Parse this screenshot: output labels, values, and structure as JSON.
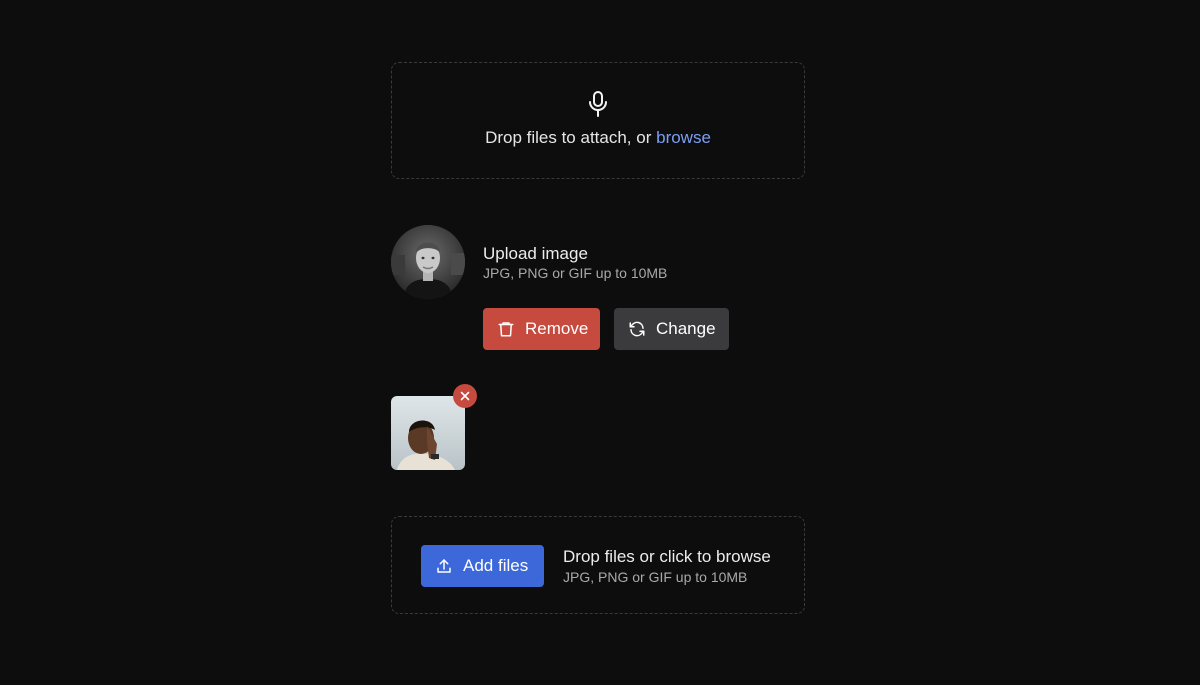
{
  "top_dropzone": {
    "icon": "microphone-icon",
    "text": "Drop files to attach, or",
    "link": "browse"
  },
  "avatar_uploader": {
    "title": "Upload image",
    "hint": "JPG, PNG or GIF up to 10MB",
    "remove_label": "Remove",
    "change_label": "Change"
  },
  "thumbnail": {
    "remove_icon": "close-icon"
  },
  "bottom_dropzone": {
    "add_label": "Add files",
    "title": "Drop files or click to browse",
    "hint": "JPG, PNG or GIF up to 10MB"
  },
  "colors": {
    "background": "#0d0d0d",
    "link": "#7b9ff5",
    "danger": "#c64a3e",
    "neutral_button": "#3b3b3e",
    "primary": "#3c68d9"
  }
}
